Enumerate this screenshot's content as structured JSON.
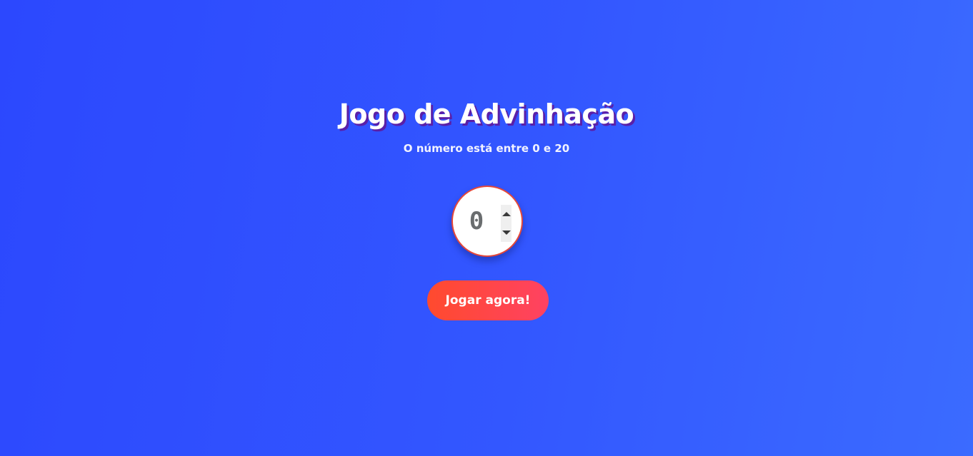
{
  "header": {
    "title": "Jogo de Advinhação",
    "subtitle": "O número está entre 0 e 20"
  },
  "guess": {
    "value": "0",
    "increment_icon": "triangle-up-icon",
    "decrement_icon": "triangle-down-icon"
  },
  "actions": {
    "play_label": "Jogar agora!"
  },
  "colors": {
    "background_start": "#2c48fe",
    "background_end": "#3b6bff",
    "title_shadow": "#5a1fa8",
    "accent_red": "#ff4a2e",
    "accent_pink": "#ff4262",
    "circle_border": "#e5483a"
  }
}
